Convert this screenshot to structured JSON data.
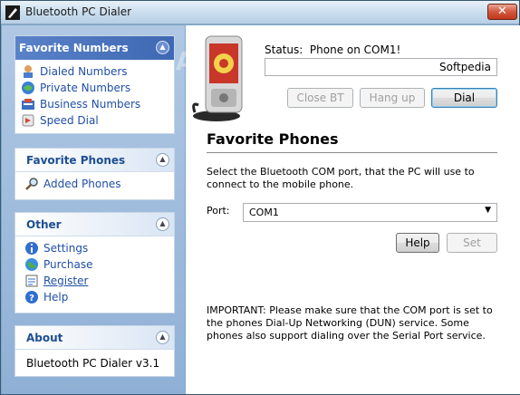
{
  "window": {
    "title": "Bluetooth PC Dialer"
  },
  "watermark": "SOFTPEDIA",
  "sidebar": {
    "favorite_numbers": {
      "title": "Favorite Numbers",
      "items": [
        {
          "label": "Dialed Numbers",
          "icon": "dialed-numbers-icon"
        },
        {
          "label": "Private Numbers",
          "icon": "private-numbers-icon"
        },
        {
          "label": "Business Numbers",
          "icon": "business-numbers-icon"
        },
        {
          "label": "Speed Dial",
          "icon": "speed-dial-icon"
        }
      ]
    },
    "favorite_phones": {
      "title": "Favorite Phones",
      "items": [
        {
          "label": "Added Phones",
          "icon": "search-icon"
        }
      ]
    },
    "other": {
      "title": "Other",
      "items": [
        {
          "label": "Settings",
          "icon": "info-icon"
        },
        {
          "label": "Purchase",
          "icon": "globe-icon"
        },
        {
          "label": "Register",
          "icon": "register-icon"
        },
        {
          "label": "Help",
          "icon": "help-icon"
        }
      ]
    },
    "about": {
      "title": "About",
      "text": "Bluetooth PC Dialer v3.1"
    }
  },
  "main": {
    "status_label": "Status:",
    "status_value": "Phone on COM1!",
    "number_field": "Softpedia",
    "buttons": {
      "close_bt": "Close BT",
      "hang_up": "Hang up",
      "dial": "Dial",
      "help": "Help",
      "set": "Set"
    },
    "heading": "Favorite Phones",
    "description": "Select the Bluetooth COM port, that the PC will use to connect to the mobile phone.",
    "port_label": "Port:",
    "port_value": "COM1",
    "important": "IMPORTANT: Please make sure that the COM port is set to the phones Dial-Up Networking (DUN) service. Some phones also support dialing over the Serial Port service."
  },
  "colors": {
    "accent": "#1f4ea8",
    "header_dark": "#4a74bf",
    "sidebar_bg": "#9fbde0"
  }
}
